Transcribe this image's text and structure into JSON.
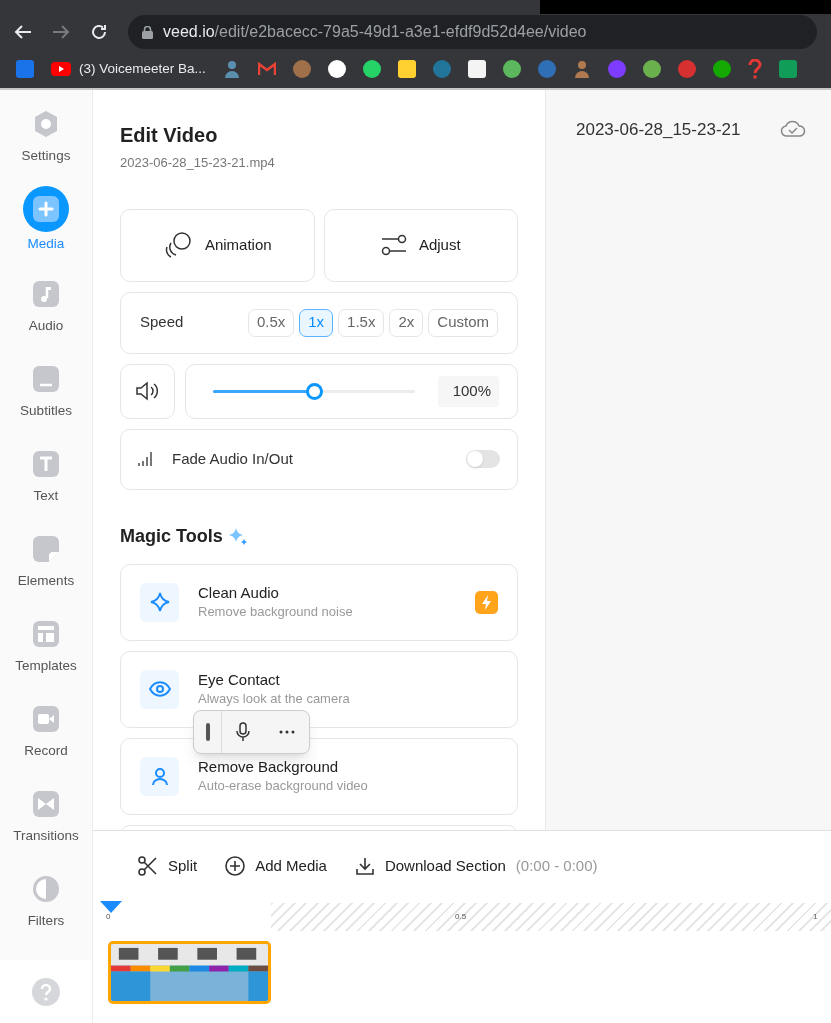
{
  "browser": {
    "url_host": "veed.io",
    "url_path": "/edit/e2bacecc-79a5-49d1-a3e1-efdf9d52d4ee/video",
    "bookmarks": [
      {
        "kind": "square",
        "color": "#1a73e8"
      },
      {
        "kind": "video",
        "label": "(3) Voicemeeter Ba..."
      },
      {
        "kind": "person",
        "color": "#5a8fb0"
      },
      {
        "kind": "mail",
        "color": "#ea4335"
      },
      {
        "kind": "circle",
        "color": "#a0704a"
      },
      {
        "kind": "circle",
        "color": "#ffffff"
      },
      {
        "kind": "circle",
        "color": "#25d366"
      },
      {
        "kind": "square",
        "color": "#ffd02f"
      },
      {
        "kind": "circle",
        "color": "#21759b"
      },
      {
        "kind": "square",
        "color": "#f4f4f4"
      },
      {
        "kind": "circle",
        "color": "#5cb85c"
      },
      {
        "kind": "circle",
        "color": "#2f6fb5"
      },
      {
        "kind": "person",
        "color": "#b07a50"
      },
      {
        "kind": "circle",
        "color": "#7d3cff"
      },
      {
        "kind": "circle",
        "color": "#6ab04c"
      },
      {
        "kind": "circle",
        "color": "#d63031"
      },
      {
        "kind": "circle",
        "color": "#14a800"
      },
      {
        "kind": "question",
        "color": "#e53935"
      },
      {
        "kind": "square",
        "color": "#0f9d58"
      }
    ]
  },
  "sidebar": {
    "items": [
      {
        "label": "Settings",
        "selected": false
      },
      {
        "label": "Media",
        "selected": true
      },
      {
        "label": "Audio",
        "selected": false
      },
      {
        "label": "Subtitles",
        "selected": false
      },
      {
        "label": "Text",
        "selected": false
      },
      {
        "label": "Elements",
        "selected": false
      },
      {
        "label": "Templates",
        "selected": false
      },
      {
        "label": "Record",
        "selected": false
      },
      {
        "label": "Transitions",
        "selected": false
      },
      {
        "label": "Filters",
        "selected": false
      }
    ]
  },
  "panel": {
    "title": "Edit Video",
    "filename": "2023-06-28_15-23-21.mp4",
    "actions": [
      "Animation",
      "Adjust"
    ],
    "speed": {
      "label": "Speed",
      "options": [
        {
          "label": "0.5x",
          "selected": false
        },
        {
          "label": "1x",
          "selected": true
        },
        {
          "label": "1.5x",
          "selected": false
        },
        {
          "label": "2x",
          "selected": false
        },
        {
          "label": "Custom",
          "selected": false
        }
      ]
    },
    "volume": {
      "level": 0.5,
      "reading": "100%"
    },
    "fade": {
      "label": "Fade Audio In/Out",
      "on": false
    },
    "magic_title": "Magic Tools",
    "tools": [
      {
        "title": "Clean Audio",
        "subtitle": "Remove background noise",
        "premium": true
      },
      {
        "title": "Eye Contact",
        "subtitle": "Always look at the camera",
        "premium": false
      },
      {
        "title": "Remove Background",
        "subtitle": "Auto-erase background video",
        "premium": false
      }
    ]
  },
  "preview": {
    "title": "2023-06-28_15-23-21"
  },
  "timeline": {
    "actions": [
      "Split",
      "Add Media",
      "Download Section"
    ],
    "range": "(0:00 - 0:00)",
    "ticks": [
      "0",
      "0.5",
      "1"
    ]
  }
}
